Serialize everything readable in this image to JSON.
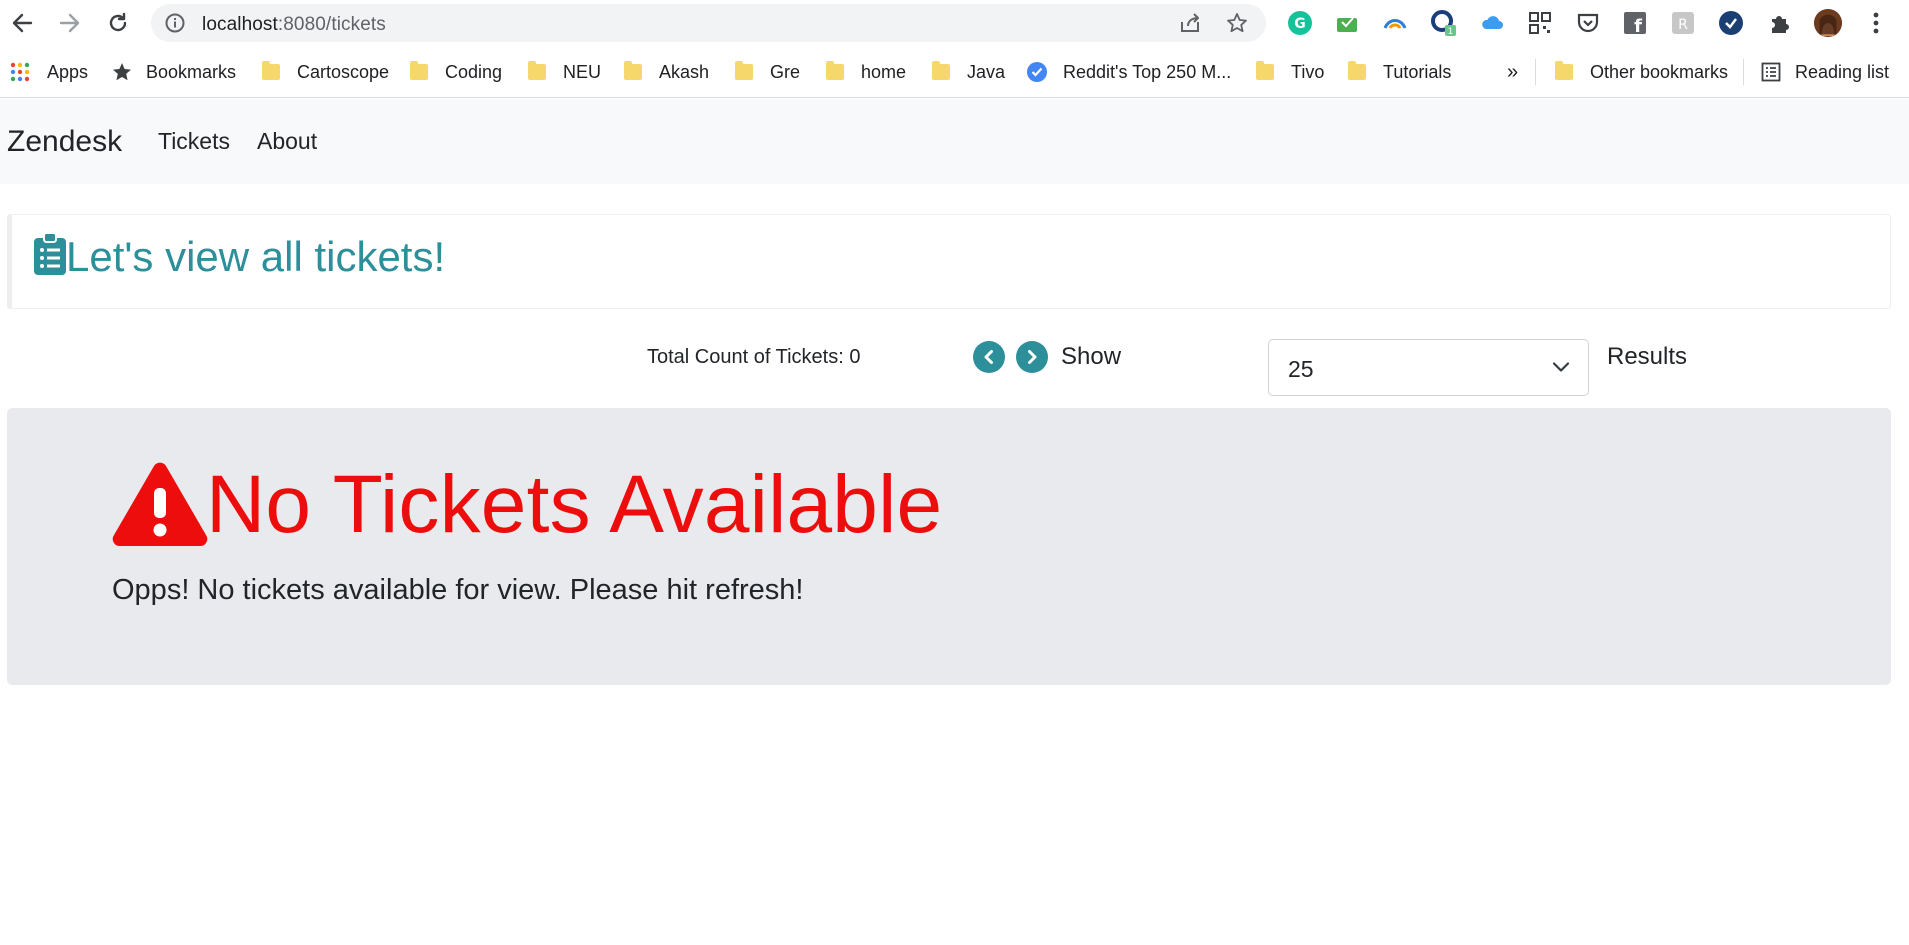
{
  "browser": {
    "url_host": "localhost",
    "url_path": ":8080/tickets",
    "bookmarks": [
      {
        "label": "Apps",
        "icon": "apps-grid-icon"
      },
      {
        "label": "Bookmarks",
        "icon": "star-icon"
      },
      {
        "label": "Cartoscope",
        "icon": "folder-icon"
      },
      {
        "label": "Coding",
        "icon": "folder-icon"
      },
      {
        "label": "NEU",
        "icon": "folder-icon"
      },
      {
        "label": "Akash",
        "icon": "folder-icon"
      },
      {
        "label": "Gre",
        "icon": "folder-icon"
      },
      {
        "label": "home",
        "icon": "folder-icon"
      },
      {
        "label": "Java",
        "icon": "folder-icon"
      },
      {
        "label": "Reddit's Top 250 M...",
        "icon": "check-circle-icon"
      },
      {
        "label": "Tivo",
        "icon": "folder-icon"
      },
      {
        "label": "Tutorials",
        "icon": "folder-icon"
      }
    ],
    "overflow_label": "»",
    "other_bookmarks": "Other bookmarks",
    "reading_list": "Reading list"
  },
  "navbar": {
    "brand": "Zendesk",
    "links": [
      "Tickets",
      "About"
    ]
  },
  "callout": {
    "title": "Let's view all tickets!"
  },
  "controls": {
    "total_count_label": "Total Count of Tickets: 0",
    "show_label": "Show",
    "page_size": "25",
    "results_label": "Results"
  },
  "empty_state": {
    "heading": "No Tickets Available",
    "message": "Opps! No tickets available for view. Please hit refresh!"
  },
  "colors": {
    "accent": "#2c8f9a",
    "error": "#ee0d0d",
    "jumbotron_bg": "#e8eaed",
    "navbar_bg": "#f8f9fa"
  }
}
